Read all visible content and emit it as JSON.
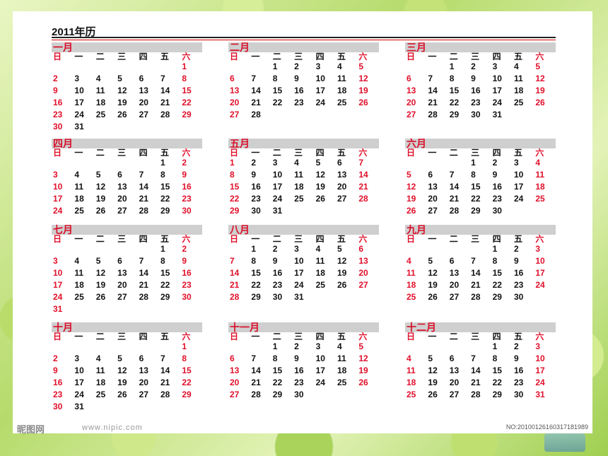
{
  "title": "2011年历",
  "weekdays": [
    "日",
    "一",
    "二",
    "三",
    "四",
    "五",
    "六"
  ],
  "months": [
    {
      "name": "一月",
      "offset": 6,
      "days": 31
    },
    {
      "name": "二月",
      "offset": 2,
      "days": 28
    },
    {
      "name": "三月",
      "offset": 2,
      "days": 31
    },
    {
      "name": "四月",
      "offset": 5,
      "days": 30
    },
    {
      "name": "五月",
      "offset": 0,
      "days": 31
    },
    {
      "name": "六月",
      "offset": 3,
      "days": 30
    },
    {
      "name": "七月",
      "offset": 5,
      "days": 31
    },
    {
      "name": "八月",
      "offset": 1,
      "days": 31
    },
    {
      "name": "九月",
      "offset": 4,
      "days": 30
    },
    {
      "name": "十月",
      "offset": 6,
      "days": 31
    },
    {
      "name": "十一月",
      "offset": 2,
      "days": 30
    },
    {
      "name": "十二月",
      "offset": 4,
      "days": 31
    }
  ],
  "footer": {
    "watermark_logo": "昵图网",
    "watermark_url": "www.nipic.com",
    "watermark_code": "NO:20100126160317181989"
  },
  "colors": {
    "weekend": "#e0102a",
    "header_bar": "#cfcfcf"
  }
}
